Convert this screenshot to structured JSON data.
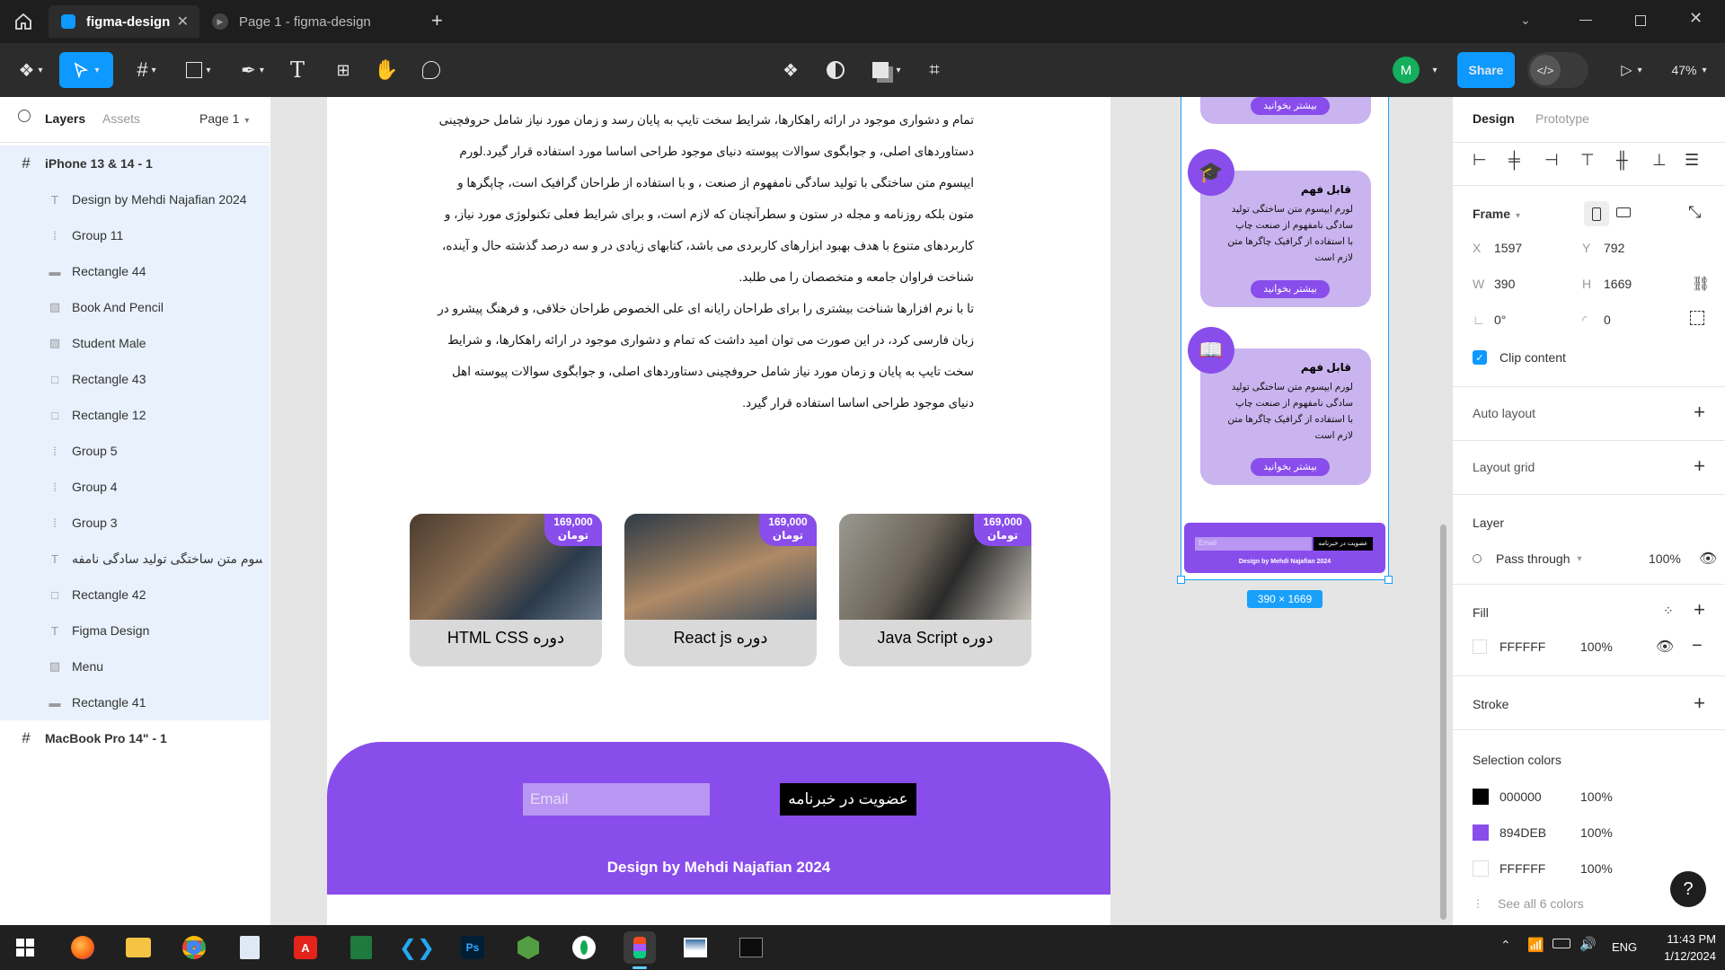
{
  "titlebar": {
    "home_icon": "home-icon",
    "tabs": [
      {
        "label": "figma-design",
        "active": true
      },
      {
        "label": "Page 1 - figma-design",
        "active": false
      }
    ]
  },
  "toolbar": {
    "avatar_letter": "M",
    "share_label": "Share",
    "zoom": "47%"
  },
  "left_panel": {
    "tab_layers": "Layers",
    "tab_assets": "Assets",
    "page": "Page 1",
    "layers": [
      {
        "name": "iPhone 13 & 14 - 1",
        "icon": "frame-icon",
        "level": 0,
        "selected": true
      },
      {
        "name": "Design by Mehdi Najafian 2024",
        "icon": "text-icon",
        "level": 1
      },
      {
        "name": "Group 11",
        "icon": "group-icon",
        "level": 1
      },
      {
        "name": "Rectangle 44",
        "icon": "line-icon",
        "level": 1
      },
      {
        "name": "Book And Pencil",
        "icon": "image-icon",
        "level": 1
      },
      {
        "name": "Student Male",
        "icon": "image-icon",
        "level": 1
      },
      {
        "name": "Rectangle 43",
        "icon": "rectangle-icon",
        "level": 1
      },
      {
        "name": "Rectangle 12",
        "icon": "rectangle-icon",
        "level": 1
      },
      {
        "name": "Group 5",
        "icon": "group-icon",
        "level": 1
      },
      {
        "name": "Group 4",
        "icon": "group-icon",
        "level": 1
      },
      {
        "name": "Group 3",
        "icon": "group-icon",
        "level": 1
      },
      {
        "name": "لورم ایپسوم متن ساختگی تولید سادگی نامفه...",
        "icon": "text-icon",
        "level": 1
      },
      {
        "name": "Rectangle 42",
        "icon": "rectangle-icon",
        "level": 1
      },
      {
        "name": "Figma Design",
        "icon": "text-icon",
        "level": 1
      },
      {
        "name": "Menu",
        "icon": "image-icon",
        "level": 1
      },
      {
        "name": "Rectangle 41",
        "icon": "line-icon",
        "level": 1
      },
      {
        "name": "MacBook Pro 14\" - 1",
        "icon": "frame-icon",
        "level": 0
      }
    ]
  },
  "canvas": {
    "paragraph_lines": [
      "تمام و دشواری موجود در ارائه راهکارها، شرایط سخت تایپ به پایان رسد و زمان مورد نیاز شامل حروفچینی",
      "دستاوردهای اصلی، و جوابگوی سوالات پیوسته  دنیای موجود طراحی اساسا مورد استفاده قرار گیرد.لورم",
      "ایپسوم متن ساختگی با تولید سادگی نامفهوم از صنعت ، و با استفاده از طراحان گرافیک است، چاپگرها و",
      "متون بلکه روزنامه و مجله در ستون و سطرآنچنان که لازم است، و برای شرایط فعلی تکنولوژی مورد نیاز، و",
      "کاربردهای متنوع با هدف بهبود ابزارهای کاربردی می باشد، کتابهای زیادی در  و سه درصد گذشته حال و آینده،",
      "شناخت فراوان جامعه و متخصصان را می طلبد.",
      "تا با نرم افزارها شناخت بیشتری را برای طراحان رایانه ای علی الخصوص طراحان خلاقی، و فرهنگ پیشرو در",
      "زبان فارسی کرد، در این صورت می توان امید داشت که تمام و دشواری موجود در ارائه راهکارها، و شرایط",
      "سخت تایپ به پایان و زمان مورد نیاز شامل حروفچینی دستاوردهای اصلی، و جوابگوی سوالات پیوسته اهل",
      "دنیای موجود طراحی اساسا استفاده قرار گیرد."
    ],
    "courses": [
      {
        "title": "HTML CSS دوره",
        "price": "169,000",
        "currency": "تومان"
      },
      {
        "title": "React js دوره",
        "price": "169,000",
        "currency": "تومان"
      },
      {
        "title": "Java Script دوره",
        "price": "169,000",
        "currency": "تومان"
      }
    ],
    "footer": {
      "email_placeholder": "Email",
      "subscribe_label": "عضویت در خبرنامه",
      "credit": "Design by Mehdi Najafian 2024"
    },
    "mobile": {
      "top_button": "بیشتر بخوانید",
      "cards": [
        {
          "title": "قابل فهم",
          "body": [
            "لورم ایپسوم متن ساختگی  تولید",
            "سادگی نامفهوم از صنعت چاپ",
            "با استفاده از گرافیک چاگرها متن",
            "لازم است"
          ],
          "button": "بیشتر بخوانید",
          "icon": "graduation-cap-icon"
        },
        {
          "title": "قابل فهم",
          "body": [
            "لورم ایپسوم متن ساختگی  تولید",
            "سادگی نامفهوم از صنعت چاپ",
            "با استفاده از گرافیک چاگرها متن",
            "لازم است"
          ],
          "button": "بیشتر بخوانید",
          "icon": "book-icon"
        }
      ],
      "footer_email": "Email",
      "footer_subscribe": "عضویت در خبرنامه",
      "footer_credit": "Design by Mehdi Najafian 2024",
      "size_badge": "390 × 1669"
    }
  },
  "right_panel": {
    "tab_design": "Design",
    "tab_prototype": "Prototype",
    "frame_label": "Frame",
    "x_label": "X",
    "x": "1597",
    "y_label": "Y",
    "y": "792",
    "w_label": "W",
    "w": "390",
    "h_label": "H",
    "h": "1669",
    "rotation": "0°",
    "radius": "0",
    "clip_content": "Clip content",
    "auto_layout": "Auto layout",
    "layout_grid": "Layout grid",
    "layer_label": "Layer",
    "blend": "Pass through",
    "opacity": "100%",
    "fill_label": "Fill",
    "fill_hex": "FFFFFF",
    "fill_opacity": "100%",
    "stroke_label": "Stroke",
    "selection_colors_label": "Selection colors",
    "selection_colors": [
      {
        "hex": "000000",
        "opacity": "100%",
        "color": "#000000"
      },
      {
        "hex": "894DEB",
        "opacity": "100%",
        "color": "#894deb"
      },
      {
        "hex": "FFFFFF",
        "opacity": "100%",
        "color": "#ffffff"
      }
    ],
    "see_all": "See all 6 colors",
    "help": "?"
  },
  "taskbar": {
    "lang": "ENG",
    "time": "11:43 PM",
    "date": "1/12/2024",
    "apps": [
      "firefox-icon",
      "file-explorer-icon",
      "chrome-icon",
      "notepad-icon",
      "acrobat-icon",
      "excel-icon",
      "vscode-icon",
      "photoshop-icon",
      "nodejs-icon",
      "mongodb-icon",
      "figma-icon",
      "photos-icon",
      "terminal-icon"
    ]
  },
  "colors": {
    "accent": "#894deb",
    "figma_blue": "#0d99ff",
    "selection": "#18a0fb"
  }
}
